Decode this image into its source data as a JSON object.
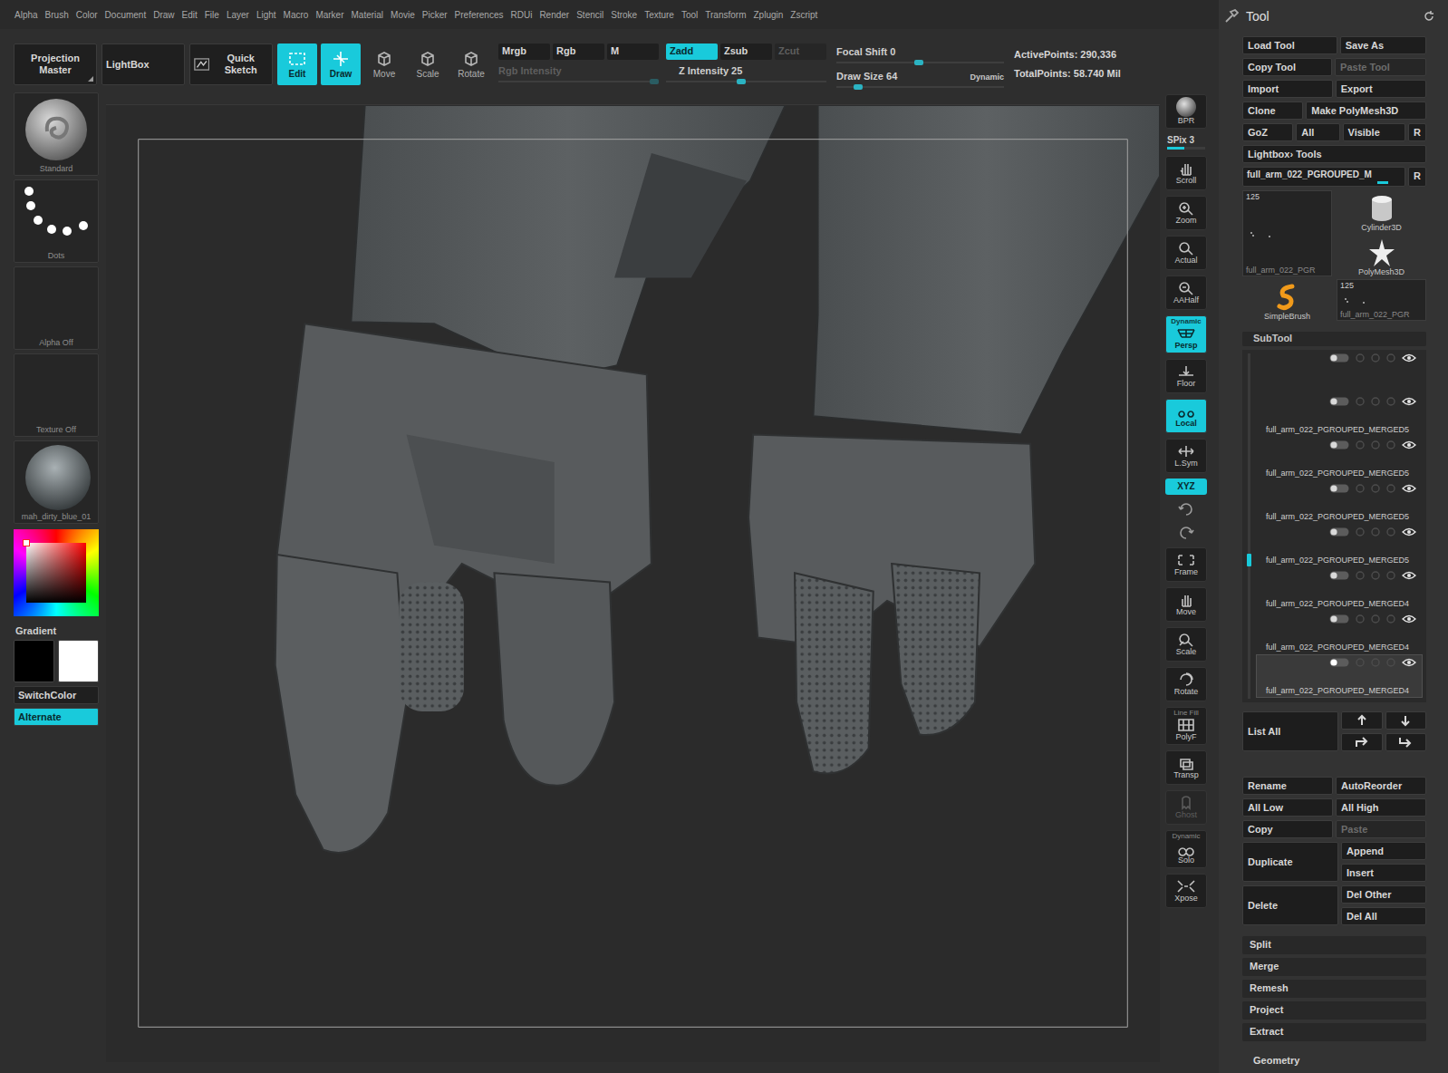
{
  "menu_bar": [
    "Alpha",
    "Brush",
    "Color",
    "Document",
    "Draw",
    "Edit",
    "File",
    "Layer",
    "Light",
    "Macro",
    "Marker",
    "Material",
    "Movie",
    "Picker",
    "Preferences",
    "RDUi",
    "Render",
    "Stencil",
    "Stroke",
    "Texture",
    "Tool",
    "Transform",
    "Zplugin",
    "Zscript"
  ],
  "top_shelf": {
    "buttons": [
      {
        "label": "Projection Master",
        "kind": "corner"
      },
      {
        "label": "LightBox",
        "kind": "plain"
      },
      {
        "label": "Quick Sketch",
        "kind": "icon"
      }
    ],
    "modes": [
      {
        "label": "Edit",
        "selected": true
      },
      {
        "label": "Draw",
        "selected": true
      },
      {
        "label": "Move",
        "selected": false
      },
      {
        "label": "Scale",
        "selected": false
      },
      {
        "label": "Rotate",
        "selected": false
      }
    ],
    "channel_modes": [
      {
        "label": "Mrgb",
        "selected": false,
        "disabled": false
      },
      {
        "label": "Rgb",
        "selected": false,
        "disabled": false
      },
      {
        "label": "M",
        "selected": false,
        "disabled": false
      }
    ],
    "depth_modes": [
      {
        "label": "Zadd",
        "selected": true,
        "disabled": false
      },
      {
        "label": "Zsub",
        "selected": false,
        "disabled": false
      },
      {
        "label": "Zcut",
        "selected": false,
        "disabled": true
      }
    ],
    "rgb_slider": {
      "label": "Rgb Intensity",
      "level": 0.97,
      "disabled": true
    },
    "z_slider": {
      "label": "Z Intensity 25",
      "level": 0.47,
      "disabled": false
    },
    "draw_sliders": [
      {
        "label": "Focal Shift 0",
        "level": 0.49
      },
      {
        "label": "Draw Size 64",
        "level": 0.13
      }
    ],
    "dynamic_label": "Dynamic",
    "stats": [
      "ActivePoints: 290,336",
      "TotalPoints: 58.740 Mil"
    ]
  },
  "left_shelf": {
    "tiles": [
      {
        "label": "Standard",
        "kind": "brush"
      },
      {
        "label": "Dots",
        "kind": "stroke"
      },
      {
        "label": "Alpha  Off",
        "kind": "empty"
      },
      {
        "label": "Texture  Off",
        "kind": "empty"
      },
      {
        "label": "mah_dirty_blue_01",
        "kind": "material"
      }
    ],
    "gradient_label": "Gradient",
    "swatches": [
      {
        "color": "#000000"
      },
      {
        "color": "#ffffff"
      }
    ],
    "buttons": [
      {
        "label": "SwitchColor",
        "selected": false
      },
      {
        "label": "Alternate",
        "selected": true
      }
    ]
  },
  "right_shelf": [
    {
      "label": "BPR",
      "kind": "sphere",
      "selected": false,
      "disabled": false
    },
    {
      "label": "SPix 3",
      "kind": "slider",
      "level": 0.45,
      "selected": false,
      "disabled": false
    },
    {
      "label": "Scroll",
      "kind": "button",
      "selected": false,
      "disabled": false
    },
    {
      "label": "Zoom",
      "kind": "button",
      "selected": false,
      "disabled": false
    },
    {
      "label": "Actual",
      "kind": "button",
      "selected": false,
      "disabled": false
    },
    {
      "label": "AAHalf",
      "kind": "button",
      "selected": false,
      "disabled": false
    },
    {
      "label": "Persp",
      "kind": "button",
      "caption": "Dynamic",
      "selected": true,
      "disabled": false
    },
    {
      "label": "Floor",
      "kind": "button",
      "selected": false,
      "disabled": false
    },
    {
      "label": "Local",
      "kind": "button",
      "selected": true,
      "disabled": false
    },
    {
      "label": "L.Sym",
      "kind": "button",
      "selected": false,
      "disabled": false
    },
    {
      "label": "XYZ",
      "kind": "toggle",
      "selected": true,
      "disabled": false
    },
    {
      "kind": "mini",
      "selected": false,
      "disabled": false
    },
    {
      "kind": "mini",
      "selected": false,
      "disabled": false
    },
    {
      "label": "Frame",
      "kind": "button",
      "selected": false,
      "disabled": false
    },
    {
      "label": "Move",
      "kind": "button",
      "selected": false,
      "disabled": false
    },
    {
      "label": "Scale",
      "kind": "button",
      "selected": false,
      "disabled": false
    },
    {
      "label": "Rotate",
      "kind": "button",
      "selected": false,
      "disabled": false
    },
    {
      "label": "PolyF",
      "kind": "button",
      "caption": "Line Fill",
      "selected": false,
      "disabled": false
    },
    {
      "label": "Transp",
      "kind": "button",
      "selected": false,
      "disabled": false
    },
    {
      "label": "Ghost",
      "kind": "button",
      "selected": false,
      "disabled": true
    },
    {
      "label": "Solo",
      "kind": "button",
      "caption": "Dynamic",
      "selected": false,
      "disabled": false
    },
    {
      "label": "Xpose",
      "kind": "button",
      "selected": false,
      "disabled": false
    }
  ],
  "tool_panel": {
    "title": "Tool",
    "button_rows": [
      [
        {
          "label": "Load Tool",
          "disabled": false
        },
        {
          "label": "Save As",
          "disabled": false
        }
      ],
      [
        {
          "label": "Copy Tool",
          "disabled": false
        },
        {
          "label": "Paste Tool",
          "disabled": true
        }
      ],
      [
        {
          "label": "Import",
          "disabled": false
        },
        {
          "label": "Export",
          "disabled": false
        }
      ],
      [
        {
          "label": "Clone",
          "disabled": false
        },
        {
          "label": "Make PolyMesh3D",
          "disabled": false
        }
      ],
      [
        {
          "label": "GoZ",
          "disabled": false
        },
        {
          "label": "All",
          "disabled": false
        },
        {
          "label": "Visible",
          "disabled": false
        },
        {
          "label": "R",
          "disabled": false
        }
      ]
    ],
    "lightbox_label": "Lightbox› Tools",
    "current_tool": {
      "label": "full_arm_022_PGROUPED_M",
      "level": 0.88,
      "reset": "R"
    },
    "thumbnails": [
      {
        "label": "full_arm_022_PGR",
        "count": "125",
        "kind": "mesh"
      },
      {
        "label": "Cylinder3D",
        "kind": "cylinder"
      },
      {
        "label": "PolyMesh3D",
        "kind": "star"
      },
      {
        "label": "SimpleBrush",
        "kind": "brush"
      },
      {
        "label": "full_arm_022_PGR",
        "count": "125",
        "kind": "mesh"
      }
    ],
    "subtool": {
      "title": "SubTool",
      "scroll_level": 0.58,
      "items": [
        {
          "visible": true,
          "selected": false
        },
        {
          "name": "full_arm_022_PGROUPED_MERGED5",
          "visible": true,
          "selected": false
        },
        {
          "name": "full_arm_022_PGROUPED_MERGED5",
          "visible": true,
          "selected": false
        },
        {
          "name": "full_arm_022_PGROUPED_MERGED5",
          "visible": true,
          "selected": false
        },
        {
          "name": "full_arm_022_PGROUPED_MERGED5",
          "visible": true,
          "selected": false
        },
        {
          "name": "full_arm_022_PGROUPED_MERGED4",
          "visible": true,
          "selected": false
        },
        {
          "name": "full_arm_022_PGROUPED_MERGED4",
          "visible": true,
          "selected": false
        },
        {
          "name": "full_arm_022_PGROUPED_MERGED4",
          "visible": true,
          "selected": true
        }
      ]
    },
    "list_all": "List  All",
    "arrow_buttons": [
      {
        "kind": "up"
      },
      {
        "kind": "down"
      },
      {
        "kind": "up-right"
      },
      {
        "kind": "down-right"
      }
    ],
    "action_rows": [
      {
        "kind": "pair",
        "buttons": [
          {
            "label": "Rename",
            "disabled": false
          },
          {
            "label": "AutoReorder",
            "disabled": false
          }
        ]
      },
      {
        "kind": "pair",
        "buttons": [
          {
            "label": "All Low",
            "disabled": false
          },
          {
            "label": "All High",
            "disabled": false
          }
        ]
      },
      {
        "kind": "pair",
        "buttons": [
          {
            "label": "Copy",
            "disabled": false
          },
          {
            "label": "Paste",
            "disabled": true
          }
        ]
      },
      {
        "kind": "tall",
        "buttons": [
          {
            "label": "Duplicate",
            "disabled": false
          },
          {
            "label": "Append",
            "disabled": false
          },
          {
            "label": "Insert",
            "disabled": false
          }
        ]
      },
      {
        "kind": "tall",
        "buttons": [
          {
            "label": "Delete",
            "disabled": false
          },
          {
            "label": "Del Other",
            "disabled": false
          },
          {
            "label": "Del All",
            "disabled": false
          }
        ]
      }
    ],
    "sections": [
      "Split",
      "Merge",
      "Remesh",
      "Project",
      "Extract"
    ],
    "next_section": "Geometry"
  }
}
